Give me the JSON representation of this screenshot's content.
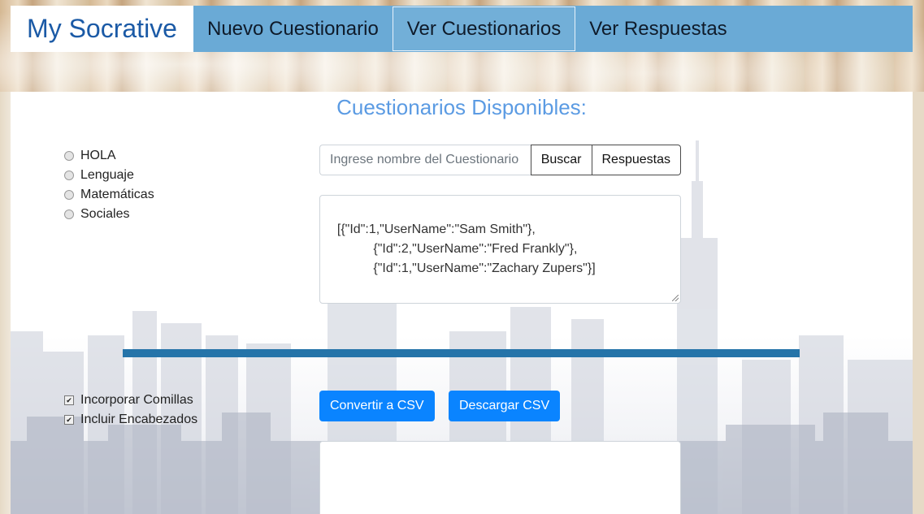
{
  "nav": {
    "brand": "My Socrative",
    "items": [
      {
        "label": "Nuevo Cuestionario",
        "active": false
      },
      {
        "label": "Ver Cuestionarios",
        "active": true
      },
      {
        "label": "Ver Respuestas",
        "active": false
      }
    ]
  },
  "page": {
    "title": "Cuestionarios Disponibles:"
  },
  "quizzes": {
    "items": [
      {
        "label": "HOLA",
        "selected": false
      },
      {
        "label": "Lenguaje",
        "selected": false
      },
      {
        "label": "Matemáticas",
        "selected": false
      },
      {
        "label": "Sociales",
        "selected": false
      }
    ]
  },
  "search": {
    "placeholder": "Ingrese nombre del Cuestionario",
    "value": "",
    "search_label": "Buscar",
    "answers_label": "Respuestas"
  },
  "json_input": {
    "value": "[{\"Id\":1,\"UserName\":\"Sam Smith\"},\n            {\"Id\":2,\"UserName\":\"Fred Frankly\"},\n            {\"Id\":1,\"UserName\":\"Zachary Zupers\"}]"
  },
  "options": {
    "quotes_label": "Incorporar Comillas",
    "quotes_checked": true,
    "headers_label": "Incluir Encabezados",
    "headers_checked": true
  },
  "actions": {
    "convert_label": "Convertir a CSV",
    "download_label": "Descargar CSV"
  },
  "csv_output": {
    "value": ""
  },
  "colors": {
    "nav_bg": "#6aaad6",
    "brand_text": "#1b5aa6",
    "title_text": "#5b9be3",
    "divider": "#2574a9",
    "primary_button": "#0a84ff"
  }
}
